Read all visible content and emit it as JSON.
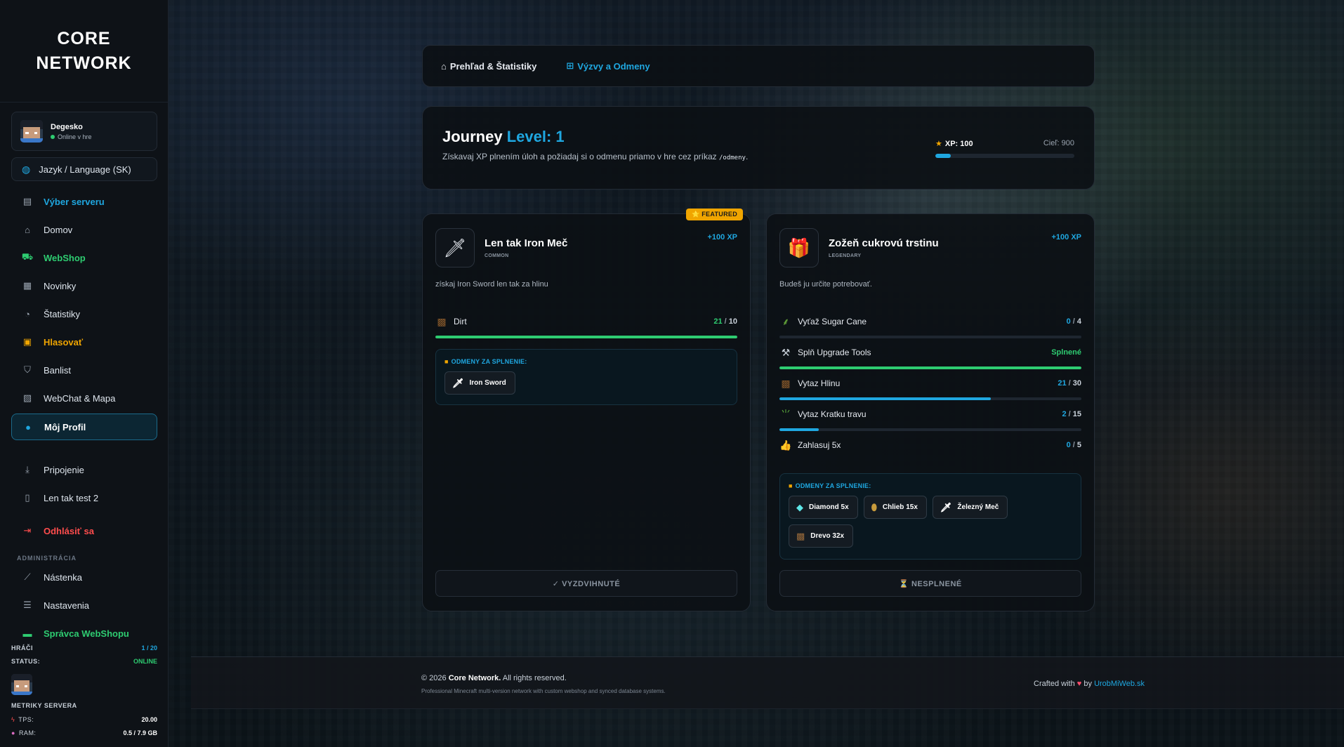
{
  "brand": {
    "line1": "CORE",
    "line2": "NETWORK"
  },
  "user": {
    "name": "Degesko",
    "status": "Online v hre"
  },
  "language": {
    "label": "Jazyk / Language (SK)",
    "icon": "globe-icon"
  },
  "nav": [
    {
      "label": "Výber serveru",
      "icon": "server-icon",
      "color": "#1fa7e0"
    },
    {
      "label": "Domov",
      "icon": "home-icon",
      "color": "#dfe6ee"
    },
    {
      "label": "WebShop",
      "icon": "cart-icon",
      "color": "#2ecc71"
    },
    {
      "label": "Novinky",
      "icon": "newspaper-icon",
      "color": "#dfe6ee"
    },
    {
      "label": "Štatistiky",
      "icon": "pie-chart-icon",
      "color": "#dfe6ee"
    },
    {
      "label": "Hlasovať",
      "icon": "vote-icon",
      "color": "#f0a500"
    },
    {
      "label": "Banlist",
      "icon": "shield-icon",
      "color": "#dfe6ee"
    },
    {
      "label": "WebChat & Mapa",
      "icon": "map-icon",
      "color": "#dfe6ee"
    },
    {
      "label": "Môj Profil",
      "icon": "user-icon",
      "color": "#ffffff"
    },
    {
      "label": "Pripojenie",
      "icon": "download-icon",
      "color": "#dfe6ee"
    },
    {
      "label": "Len tak test 2",
      "icon": "file-icon",
      "color": "#dfe6ee"
    },
    {
      "label": "Odhlásiť sa",
      "icon": "logout-icon",
      "color": "#ff4d4d"
    }
  ],
  "admin": {
    "section_label": "ADMINISTRÁCIA",
    "items": [
      {
        "label": "Nástenka",
        "icon": "line-chart-icon",
        "color": "#dfe6ee"
      },
      {
        "label": "Nastavenia",
        "icon": "sliders-icon",
        "color": "#dfe6ee"
      },
      {
        "label": "Správca WebShopu",
        "icon": "store-icon",
        "color": "#2ecc71"
      }
    ]
  },
  "server": {
    "players_label": "HRÁČI",
    "players_value": "1 / 20",
    "status_label": "STATUS:",
    "status_value": "ONLINE",
    "metrics_title": "METRIKY SERVERA",
    "tps_label": "TPS:",
    "tps_value": "20.00",
    "ram_label": "RAM:",
    "ram_value": "0.5 / 7.9 GB"
  },
  "tabs": [
    {
      "label": "Prehľad & Štatistiky",
      "icon": "home-icon",
      "color": "#e6eaf0"
    },
    {
      "label": "Výzvy a Odmeny",
      "icon": "gift-icon",
      "color": "#1fa7e0"
    }
  ],
  "journey": {
    "title": "Journey",
    "level": "Level: 1",
    "description": "Získavaj XP plnením úloh a požiadaj si o odmenu priamo v hre cez príkaz",
    "command": "/odmeny",
    "xp_label": "XP: 100",
    "goal_label": "Cieľ: 900",
    "progress": 0.11,
    "accent": "#1fa7e0"
  },
  "cards": [
    {
      "badge": "⭐ FEATURED",
      "name": "Len tak Iron Meč",
      "rarity": "COMMON",
      "xp": "+100 XP",
      "description": "získaj Iron Sword len tak za hlinu",
      "icon": "sword-icon",
      "tasks": [
        {
          "label": "Dirt",
          "icon": "dirt-block-icon",
          "current": "21",
          "sep": " / ",
          "target": "10",
          "progress": 1.0,
          "color": "#2ecc71"
        }
      ],
      "rewards_title": "ODMENY ZA SPLNENIE:",
      "rewards": [
        {
          "label": "Iron Sword",
          "icon": "sword-icon"
        }
      ],
      "claim_label": "✓ VYZDVIHNUTÉ"
    },
    {
      "name": "Zožeň cukrovú trstinu",
      "rarity": "LEGENDARY",
      "xp": "+100 XP",
      "description": "Budeš ju určite potrebovať.",
      "icon": "gift-icon",
      "tasks": [
        {
          "label": "Vyťaž Sugar Cane",
          "icon": "sugar-cane-icon",
          "current": "0",
          "sep": " / ",
          "target": "4",
          "progress": 0.0,
          "color": "#1fa7e0"
        },
        {
          "label": "Splň Upgrade Tools",
          "icon": "tools-icon",
          "done_label": "Splnené",
          "progress": 1.0,
          "color": "#2ecc71"
        },
        {
          "label": "Vytaz Hlinu",
          "icon": "dirt-block-icon",
          "current": "21",
          "sep": " / ",
          "target": "30",
          "progress": 0.7,
          "color": "#1fa7e0"
        },
        {
          "label": "Vytaz Kratku travu",
          "icon": "grass-icon",
          "current": "2",
          "sep": " / ",
          "target": "15",
          "progress": 0.13,
          "color": "#1fa7e0"
        },
        {
          "label": "Zahlasuj 5x",
          "icon": "thumbs-up-icon",
          "current": "0",
          "sep": " / ",
          "target": "5",
          "progress": 0.0,
          "color": "#1fa7e0"
        }
      ],
      "rewards_title": "ODMENY ZA SPLNENIE:",
      "rewards": [
        {
          "label": "Diamond 5x",
          "icon": "diamond-icon"
        },
        {
          "label": "Chlieb 15x",
          "icon": "bread-icon"
        },
        {
          "label": "Železný Meč",
          "icon": "sword-icon"
        },
        {
          "label": "Drevo 32x",
          "icon": "wood-icon"
        }
      ],
      "claim_label": "⏳ NESPLNENÉ"
    }
  ],
  "footer": {
    "copy_prefix": "© 2026",
    "copy_brand": "Core Network.",
    "copy_suffix": "All rights reserved.",
    "subtitle": "Professional Minecraft multi-version network with custom webshop and synced database systems.",
    "crafted": "Crafted with",
    "heart": "♥",
    "by": "by",
    "link": "UrobMiWeb.sk"
  }
}
